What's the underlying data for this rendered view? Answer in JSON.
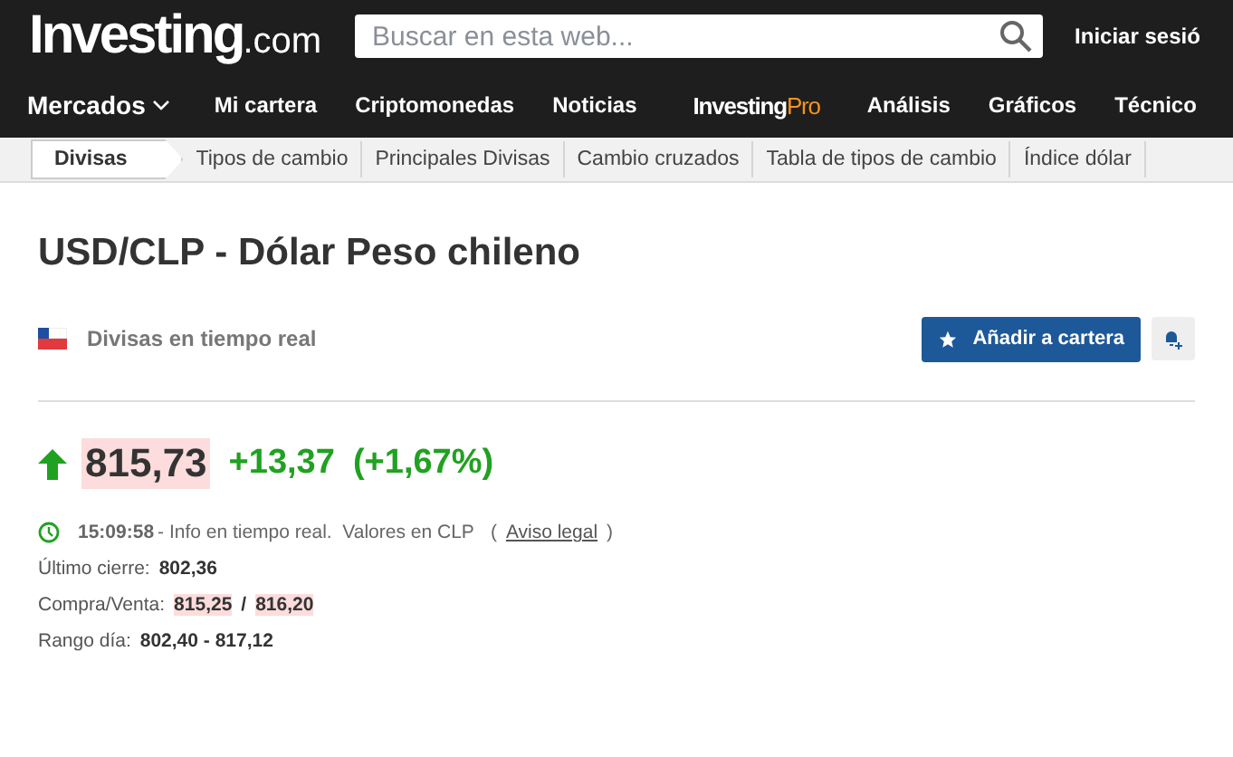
{
  "header": {
    "logo_main": "Investing",
    "logo_suffix": ".com",
    "search": {
      "placeholder": "Buscar en esta web..."
    },
    "login": "Iniciar sesió"
  },
  "nav": [
    {
      "label": "Mercados",
      "kind": "dropdown"
    },
    {
      "label": "Mi cartera",
      "kind": "link"
    },
    {
      "label": "Criptomonedas",
      "kind": "link"
    },
    {
      "label": "Noticias",
      "kind": "link"
    },
    {
      "label": "Investing",
      "label_accent": "Pro",
      "kind": "brand"
    },
    {
      "label": "Análisis",
      "kind": "link"
    },
    {
      "label": "Gráficos",
      "kind": "link"
    },
    {
      "label": "Técnico",
      "kind": "link"
    }
  ],
  "subnav": [
    {
      "label": "Divisas",
      "selected": true
    },
    {
      "label": "Tipos de cambio",
      "selected": false
    },
    {
      "label": "Principales Divisas",
      "selected": false
    },
    {
      "label": "Cambio cruzados",
      "selected": false
    },
    {
      "label": "Tabla de tipos de cambio",
      "selected": false
    },
    {
      "label": "Índice dólar",
      "selected": false
    }
  ],
  "title": "USD/CLP - Dólar Peso chileno",
  "market": {
    "label": "Divisas en tiempo real",
    "add_button": "Añadir a cartera"
  },
  "quote": {
    "up": true,
    "price": "815,73",
    "change": "+13,37",
    "change_pct": "(+1,67%)",
    "time": "15:09:58",
    "info": "- Info en tiempo real.  Valores en CLP",
    "legal_open": "(",
    "legal": "Aviso legal",
    "legal_close": ")"
  },
  "stats": [
    {
      "label": "Último cierre:",
      "values": [
        {
          "text": "802,36",
          "highlight": false
        }
      ]
    },
    {
      "label": "Compra/Venta:",
      "values": [
        {
          "text": "815,25",
          "highlight": true
        },
        {
          "text": "/",
          "highlight": false
        },
        {
          "text": "816,20",
          "highlight": true
        }
      ]
    },
    {
      "label": "Rango día:",
      "values": [
        {
          "text": "802,40 - 817,12",
          "highlight": false
        }
      ]
    }
  ]
}
